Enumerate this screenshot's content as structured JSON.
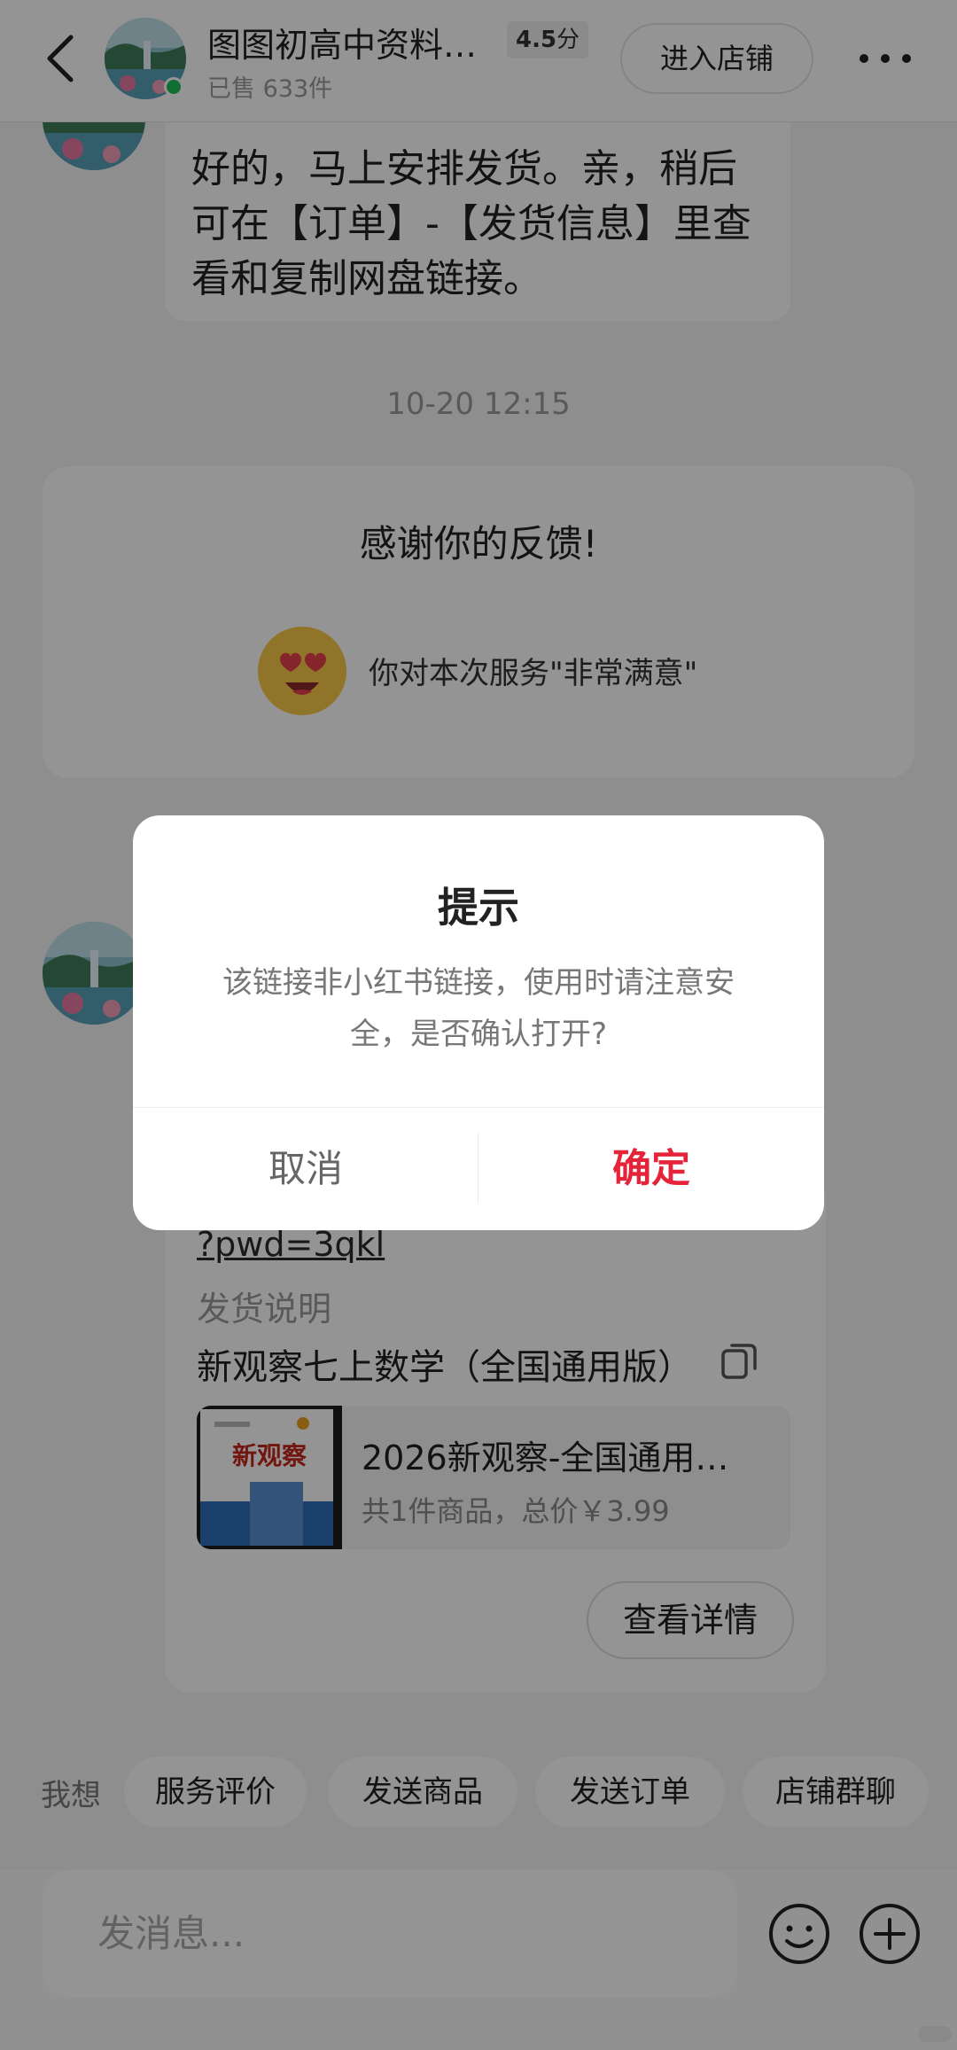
{
  "header": {
    "back_icon": "chevron-left-icon",
    "shop_name": "图图初高中资料…",
    "rating_value": "4.5",
    "rating_unit": "分",
    "sold": "已售 633件",
    "enter_shop_label": "进入店铺",
    "more_icon": "more-dots-icon",
    "online_color": "#1fc05a"
  },
  "chat": {
    "seller_message": "好的，马上安排发货。亲，稍后可在【订单】-【发货信息】里查看和复制网盘链接。",
    "timestamp": "10-20 12:15",
    "feedback": {
      "title": "感谢你的反馈!",
      "emoji_icon": "heart-eyes-emoji-icon",
      "text": "你对本次服务\"非常满意\""
    },
    "order_message": {
      "link_text": "?pwd=3qkl",
      "ship_note_label": "发货说明",
      "ship_note": "新观察七上数学（全国通用版）",
      "copy_icon": "copy-icon",
      "product": {
        "thumb_title": "新观察",
        "name": "2026新观察-全国通用…",
        "summary": "共1件商品，总价￥3.99"
      },
      "view_detail_label": "查看详情"
    }
  },
  "quick_actions": {
    "label": "我想",
    "chips": [
      "服务评价",
      "发送商品",
      "发送订单",
      "店铺群聊"
    ]
  },
  "composer": {
    "placeholder": "发消息...",
    "emoji_icon": "smiley-icon",
    "plus_icon": "plus-circle-icon"
  },
  "dialog": {
    "title": "提示",
    "message": "该链接非小红书链接，使用时请注意安全，是否确认打开?",
    "cancel_label": "取消",
    "confirm_label": "确定",
    "confirm_color": "#e5243a"
  }
}
